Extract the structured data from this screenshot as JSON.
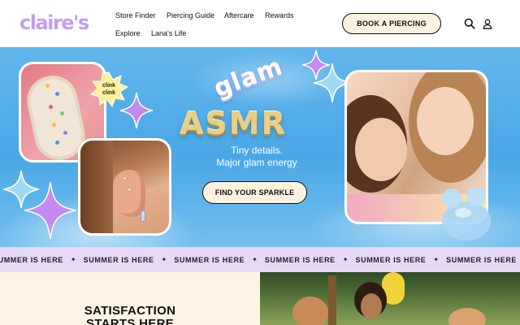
{
  "header": {
    "logo_text": "claire's",
    "nav": {
      "store_finder": "Store Finder",
      "piercing_guide": "Piercing Guide",
      "aftercare": "Aftercare",
      "rewards": "Rewards",
      "explore": "Explore",
      "lanas_life": "Lana's Life"
    },
    "book_button": "BOOK A PIERCING",
    "icons": [
      "search-icon",
      "account-icon"
    ]
  },
  "hero": {
    "title_top": "glam",
    "title_main": "ASMR",
    "tagline_line1": "Tiny details.",
    "tagline_line2": "Major glam energy",
    "cta_label": "FIND YOUR SPARKLE",
    "sticker_line1": "clink",
    "sticker_line2": "clink",
    "colors": {
      "sky": "#4aa7e6",
      "button_bg": "#fbf1df",
      "sparkle_purple": "#c48af2",
      "sparkle_blue": "#9fdaf5"
    }
  },
  "ticker": {
    "phrase": "SUMMER IS HERE",
    "separator": "✦",
    "repeat_count": 7,
    "background": "#e8d9f7"
  },
  "promo": {
    "heading_line1": "SATISFACTION",
    "heading_line2": "STARTS HERE"
  },
  "theme": {
    "logo_color": "#c39ef0",
    "text": "#111111"
  }
}
